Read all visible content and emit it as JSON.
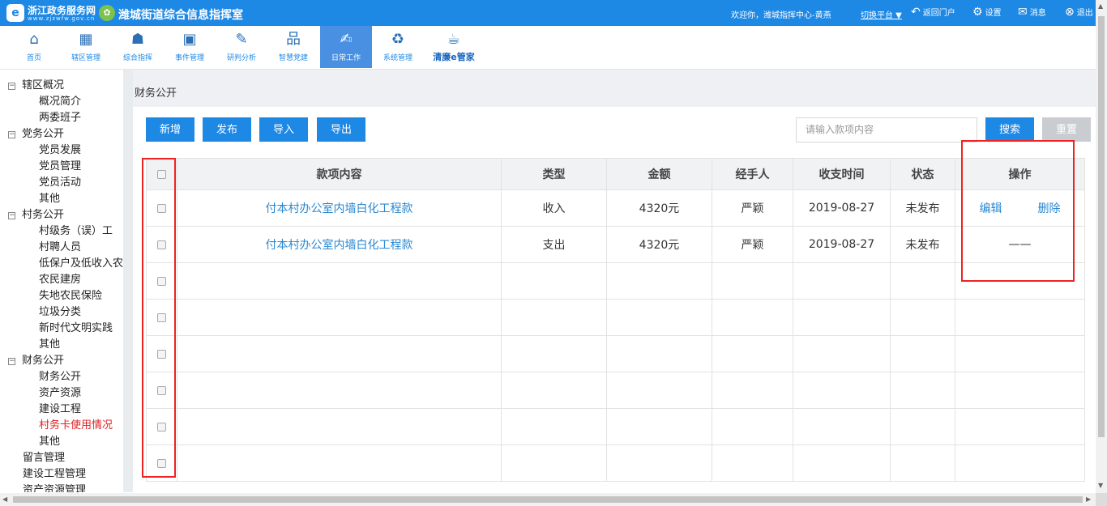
{
  "header": {
    "gov_name": "浙江政务服务网",
    "gov_url": "www.zjzwfw.gov.cn",
    "app_title": "潍城街道综合信息指挥室",
    "welcome": "欢迎你，潍城指挥中心-黄燕",
    "switch_platform": "切换平台 ▼",
    "nav": [
      "返回门户",
      "设置",
      "消息",
      "退出"
    ]
  },
  "menu": {
    "items": [
      {
        "label": "首页",
        "icon": "home-icon"
      },
      {
        "label": "辖区管理",
        "icon": "grid-icon"
      },
      {
        "label": "综合指挥",
        "icon": "command-icon"
      },
      {
        "label": "事件管理",
        "icon": "event-icon"
      },
      {
        "label": "研判分析",
        "icon": "analysis-icon"
      },
      {
        "label": "智慧党建",
        "icon": "org-icon"
      },
      {
        "label": "日常工作",
        "icon": "daily-work-icon"
      },
      {
        "label": "系统管理",
        "icon": "system-icon"
      },
      {
        "label": "清廉e管家",
        "icon": "qinglian-icon"
      }
    ],
    "active_index": 6
  },
  "sidebar": {
    "items": [
      {
        "label": "辖区概况",
        "level": 0,
        "toggle": "⊟"
      },
      {
        "label": "概况简介",
        "level": 1
      },
      {
        "label": "两委班子",
        "level": 1
      },
      {
        "label": "党务公开",
        "level": 0,
        "toggle": "⊟"
      },
      {
        "label": "党员发展",
        "level": 1
      },
      {
        "label": "党员管理",
        "level": 1
      },
      {
        "label": "党员活动",
        "level": 1
      },
      {
        "label": "其他",
        "level": 1
      },
      {
        "label": "村务公开",
        "level": 0,
        "toggle": "⊟"
      },
      {
        "label": "村级务（误）工",
        "level": 1
      },
      {
        "label": "村聘人员",
        "level": 1
      },
      {
        "label": "低保户及低收入农户",
        "level": 1
      },
      {
        "label": "农民建房",
        "level": 1
      },
      {
        "label": "失地农民保险",
        "level": 1
      },
      {
        "label": "垃圾分类",
        "level": 1
      },
      {
        "label": "新时代文明实践",
        "level": 1
      },
      {
        "label": "其他",
        "level": 1
      },
      {
        "label": "财务公开",
        "level": 0,
        "toggle": "⊟"
      },
      {
        "label": "财务公开",
        "level": 1
      },
      {
        "label": "资产资源",
        "level": 1
      },
      {
        "label": "建设工程",
        "level": 1
      },
      {
        "label": "村务卡使用情况",
        "level": 1,
        "selected": true
      },
      {
        "label": "其他",
        "level": 1
      },
      {
        "label": "留言管理",
        "level": 0
      },
      {
        "label": "建设工程管理",
        "level": 0
      },
      {
        "label": "资产资源管理",
        "level": 0
      }
    ]
  },
  "breadcrumb": "财务公开",
  "toolbar": {
    "add": "新增",
    "publish": "发布",
    "import": "导入",
    "export": "导出",
    "search_placeholder": "请输入款项内容",
    "search": "搜索",
    "reset": "重置"
  },
  "table": {
    "columns": [
      "款项内容",
      "类型",
      "金额",
      "经手人",
      "收支时间",
      "状态",
      "操作"
    ],
    "rows": [
      {
        "content": "付本村办公室内墙白化工程款",
        "type": "收入",
        "amount": "4320元",
        "handler": "严颖",
        "date": "2019-08-27",
        "status": "未发布",
        "actions": [
          "编辑",
          "删除"
        ]
      },
      {
        "content": "付本村办公室内墙白化工程款",
        "type": "支出",
        "amount": "4320元",
        "handler": "严颖",
        "date": "2019-08-27",
        "status": "未发布",
        "no_action": "——"
      }
    ],
    "empty_rows": 6
  },
  "colors": {
    "primary": "#1e88e5",
    "highlight": "#ee2222",
    "link": "#2a87d0",
    "selected_text": "#e02020"
  }
}
